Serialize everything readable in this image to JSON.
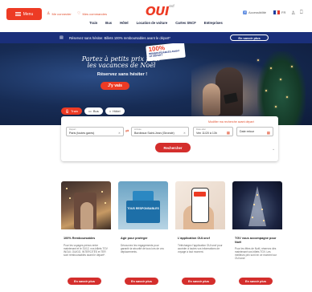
{
  "header": {
    "menu_label": "Menu",
    "links": [
      {
        "icon": "user-icon",
        "label": "Me connecter"
      },
      {
        "icon": "heart-icon",
        "label": "Mes commandes"
      }
    ],
    "logo": "OUI",
    "logo_suffix": "sncf",
    "accessibility_label": "Accessibilité",
    "language": "FR",
    "nav": [
      "Train",
      "Bus",
      "Hôtel",
      "Location de voiture",
      "Cartes SNCF",
      "Entreprises"
    ]
  },
  "promo_bar": {
    "text": "Réservez sans hésiter. Billets 100% remboursables avant le départ*",
    "button": "En savoir plus"
  },
  "hero": {
    "headline": "Partez à petits prix pour les vacances de Noël",
    "subline": "Réservez sans hésiter !",
    "cta": "J'y vais",
    "badge_pct": "100%",
    "badge_text": "REMBOURSABLES AVANT LE DÉPART"
  },
  "tabs": [
    {
      "label": "Train",
      "active": true
    },
    {
      "label": "Bus",
      "active": false
    },
    {
      "label": "Hôtel",
      "active": false
    }
  ],
  "search": {
    "modify_link": "Modifier ma recherche avant départ",
    "departure_label": "Départ",
    "departure_value": "Paris (toutes gares)",
    "arrival_label": "Arrivée",
    "arrival_value": "Bordeaux Saint-Jean (Gironde)",
    "date_label": "Date aller",
    "date_value": "Ven 11/20 à 13h",
    "return_label": "",
    "return_value": "Date retour",
    "button": "Rechercher"
  },
  "cards": [
    {
      "title": "100% Remboursables",
      "desc": "Pour les voyages prévus entre maintenant et le 31/12, nos billets TGV INOUI, OUIGO, INTERCITÉS et TER sont remboursables avant le départ*.",
      "button": "En savoir plus",
      "image_caption": ""
    },
    {
      "title": "Agir pour protéger",
      "desc": "Découvrez les engagements pour garantir la sécurité de tous lors de vos déplacements.",
      "button": "En savoir plus",
      "image_caption": "TOUS RESPONSABLES"
    },
    {
      "title": "L'application OUI.sncf",
      "desc": "Téléchargez l'application OUI.sncf pour accéder à toutes vos informations de voyage à tout moment.",
      "button": "En savoir plus",
      "image_caption": ""
    },
    {
      "title": "TGV vous accompagne pour Noël",
      "desc": "Pour les fêtes de Noël, réservez dès maintenant vos billets TGV. Les meilleurs prix sont en ce moment sur OUI.sncf.",
      "button": "En savoir plus",
      "image_caption": ""
    }
  ]
}
